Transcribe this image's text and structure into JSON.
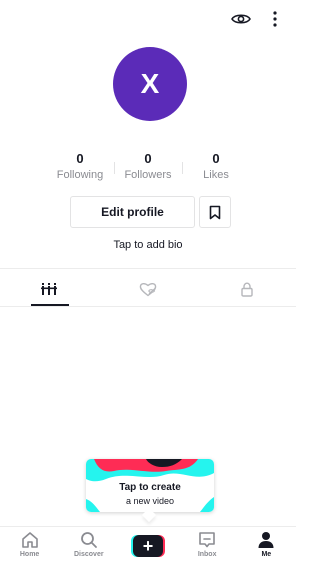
{
  "header": {
    "view_icon": "eye-icon",
    "more_icon": "more-vertical-icon"
  },
  "profile": {
    "avatar_letter": "X",
    "avatar_color": "#5b2bb8"
  },
  "stats": [
    {
      "value": "0",
      "label": "Following"
    },
    {
      "value": "0",
      "label": "Followers"
    },
    {
      "value": "0",
      "label": "Likes"
    }
  ],
  "actions": {
    "edit_profile": "Edit profile",
    "bookmark_icon": "bookmark-icon"
  },
  "bio": {
    "placeholder": "Tap to add bio"
  },
  "tabs": [
    {
      "icon": "videos-grid-icon",
      "active": true
    },
    {
      "icon": "liked-hidden-icon",
      "active": false
    },
    {
      "icon": "lock-icon",
      "active": false
    }
  ],
  "create_card": {
    "title": "Tap to create",
    "subtitle": "a new video"
  },
  "nav": [
    {
      "label": "Home",
      "icon": "home-icon"
    },
    {
      "label": "Discover",
      "icon": "search-icon"
    },
    {
      "label": "",
      "icon": "plus-icon"
    },
    {
      "label": "Inbox",
      "icon": "inbox-icon"
    },
    {
      "label": "Me",
      "icon": "profile-icon",
      "active": true
    }
  ],
  "colors": {
    "accent_pink": "#fe2c55",
    "accent_cyan": "#25f4ee",
    "text_dark": "#161823",
    "text_muted": "#8a8b91"
  }
}
